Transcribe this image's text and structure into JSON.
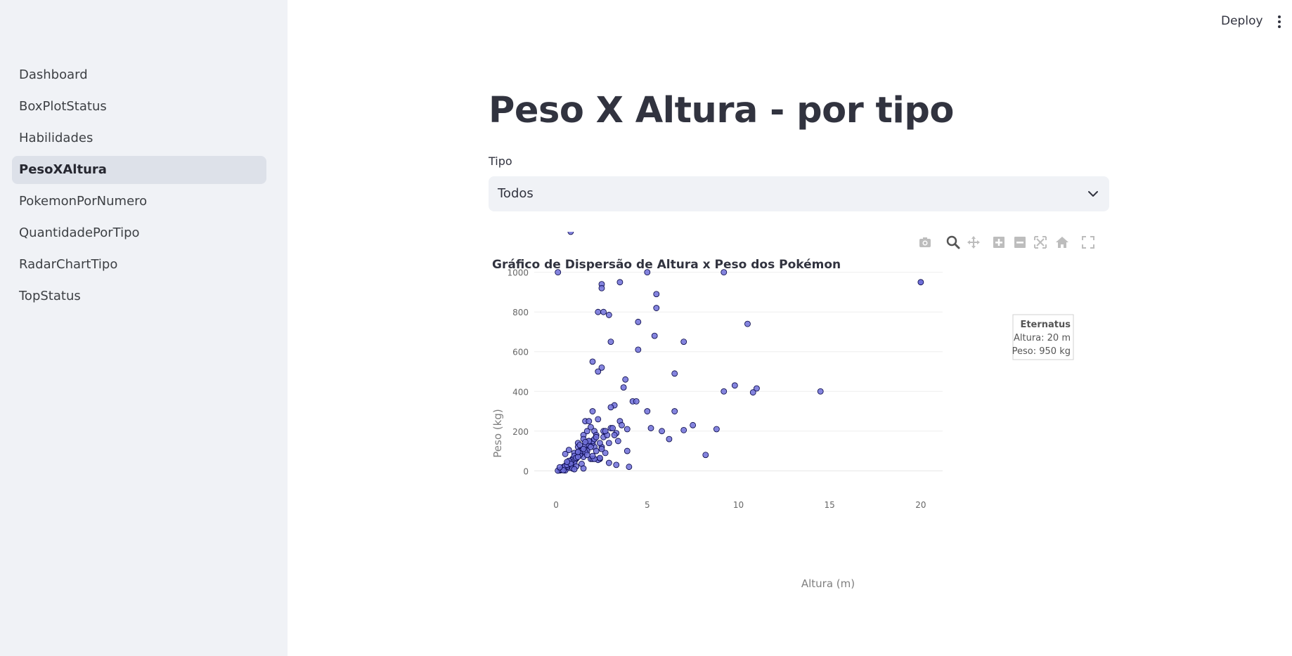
{
  "sidebar": {
    "items": [
      {
        "label": "Dashboard"
      },
      {
        "label": "BoxPlotStatus"
      },
      {
        "label": "Habilidades"
      },
      {
        "label": "PesoXAltura"
      },
      {
        "label": "PokemonPorNumero"
      },
      {
        "label": "QuantidadePorTipo"
      },
      {
        "label": "RadarChartTipo"
      },
      {
        "label": "TopStatus"
      }
    ],
    "active_item": "PesoXAltura"
  },
  "header": {
    "deploy_label": "Deploy"
  },
  "main": {
    "title": "Peso X Altura - por tipo",
    "select": {
      "label": "Tipo",
      "value": "Todos"
    }
  },
  "modebar": {
    "icons": [
      "camera-icon",
      "zoom-icon",
      "pan-icon",
      "zoom-in-icon",
      "zoom-out-icon",
      "autoscale-icon",
      "reset-axes-icon",
      "fullscreen-icon"
    ],
    "active_icon": "zoom-icon"
  },
  "tooltip": {
    "name": "Eternatus",
    "line1": "Altura: 20 m",
    "line2": "Peso: 950 kg"
  },
  "colors": {
    "marker": "#6f6fd8",
    "marker_edge": "#000040",
    "accent": "#ff4b4b"
  },
  "chart_data": {
    "type": "scatter",
    "title": "Gráfico de Dispersão de Altura x Peso dos Pokémon",
    "xlabel": "Altura (m)",
    "ylabel": "Peso (kg)",
    "xlim": [
      -1.2,
      21.2
    ],
    "ylim": [
      -20,
      1020
    ],
    "xticks": [
      0,
      5,
      10,
      15,
      20
    ],
    "yticks": [
      0,
      200,
      400,
      600,
      800,
      1000
    ],
    "grid": true,
    "legend": "none",
    "x": [
      0.1,
      2.5,
      2.5,
      3.5,
      5.0,
      5.5,
      9.2,
      2.3,
      2.6,
      2.9,
      5.5,
      4.5,
      10.5,
      5.4,
      7.0,
      3.0,
      4.5,
      2.0,
      2.5,
      6.5,
      2.3,
      3.8,
      3.7,
      9.8,
      11.0,
      9.2,
      10.8,
      14.5,
      4.2,
      4.4,
      3.2,
      3.0,
      5.0,
      6.5,
      7.5,
      5.8,
      5.2,
      7.0,
      8.8,
      6.2,
      8.2,
      4.0,
      3.9,
      3.0,
      3.5,
      3.3,
      2.6,
      2.1,
      2.0,
      1.6,
      1.7,
      1.5,
      1.8,
      2.2,
      2.5,
      1.2,
      1.4,
      1.9,
      2.7,
      2.4,
      2.1,
      1.3,
      0.9,
      1.0,
      0.8,
      1.1,
      0.6,
      0.7,
      0.5,
      0.4,
      0.3,
      0.2,
      0.5,
      1.0,
      1.5,
      2.0,
      1.2,
      0.9,
      0.7,
      1.3,
      1.7,
      1.1,
      0.8,
      0.6,
      0.4,
      1.8,
      2.2,
      1.6,
      1.4,
      1.0,
      0.3,
      0.2,
      0.1,
      0.4,
      0.6,
      0.9,
      1.2,
      1.5,
      1.9,
      2.3,
      2.8,
      2.0,
      1.7,
      1.3,
      0.8,
      0.5,
      1.0,
      1.4,
      1.8,
      2.1,
      2.6,
      3.1,
      3.6,
      3.2,
      2.9,
      0.7,
      1.1,
      1.6,
      2.4,
      1.9,
      1.2,
      0.6,
      0.3,
      0.8,
      1.5,
      2.2,
      2.7,
      3.4,
      3.9,
      2.5,
      2.0,
      1.4,
      0.9,
      0.5,
      1.3,
      1.8,
      2.3,
      1.1,
      0.7,
      1.6,
      2.1,
      2.9,
      3.3,
      1.0,
      0.4,
      0.2,
      0.6,
      1.2,
      1.7,
      2.0,
      2.4,
      1.5,
      0.8
    ],
    "y": [
      1000,
      940,
      920,
      950,
      1000,
      890,
      1000,
      800,
      800,
      785,
      820,
      750,
      740,
      680,
      650,
      650,
      610,
      550,
      520,
      490,
      500,
      460,
      420,
      430,
      415,
      400,
      395,
      400,
      350,
      350,
      330,
      320,
      300,
      300,
      230,
      200,
      215,
      205,
      210,
      160,
      80,
      20,
      210,
      215,
      250,
      190,
      170,
      120,
      300,
      250,
      200,
      180,
      150,
      100,
      120,
      140,
      110,
      60,
      90,
      60,
      200,
      80,
      40,
      50,
      30,
      60,
      25,
      15,
      10,
      8,
      5,
      3,
      2,
      90,
      70,
      140,
      120,
      60,
      40,
      100,
      110,
      70,
      30,
      20,
      15,
      250,
      180,
      130,
      90,
      40,
      4,
      2,
      1,
      20,
      35,
      55,
      90,
      160,
      220,
      260,
      180,
      150,
      100,
      80,
      45,
      25,
      75,
      100,
      130,
      160,
      200,
      215,
      230,
      180,
      140,
      50,
      65,
      95,
      140,
      120,
      70,
      30,
      5,
      35,
      110,
      170,
      200,
      150,
      100,
      110,
      60,
      35,
      12,
      85,
      130,
      150,
      55,
      22,
      105,
      145,
      60,
      40,
      30,
      8,
      3,
      18,
      45,
      95,
      80,
      75,
      65,
      12
    ]
  }
}
